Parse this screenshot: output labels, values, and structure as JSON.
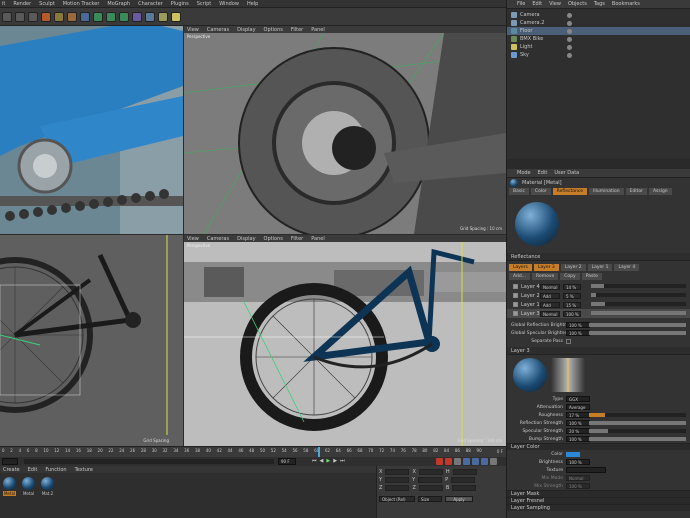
{
  "menubar": {
    "items": [
      "it",
      "Render",
      "Sculpt",
      "Motion Tracker",
      "MoGraph",
      "Character",
      "Plugins",
      "Script",
      "Window",
      "Help"
    ]
  },
  "viewports": {
    "menu": [
      "View",
      "Cameras",
      "Display",
      "Options",
      "Filter",
      "Panel"
    ],
    "tl": {
      "grid": ""
    },
    "tr": {
      "title": "Perspective",
      "grid": "Grid Spacing : 10 cm"
    },
    "bl": {
      "grid": "Grid Spacing"
    },
    "br": {
      "title": "Perspective",
      "grid": "Grid Spacing : 100 cm"
    }
  },
  "timeline": {
    "ticks": [
      "0",
      "2",
      "4",
      "6",
      "8",
      "10",
      "12",
      "14",
      "16",
      "18",
      "20",
      "22",
      "24",
      "26",
      "28",
      "30",
      "32",
      "34",
      "36",
      "38",
      "40",
      "42",
      "44",
      "46",
      "48",
      "50",
      "52",
      "54",
      "56",
      "58",
      "60",
      "62",
      "64",
      "66",
      "68",
      "70",
      "72",
      "74",
      "76",
      "78",
      "80",
      "82",
      "84",
      "86",
      "88",
      "90"
    ],
    "end": "0 F"
  },
  "playbar": {
    "frame": "90 F"
  },
  "matbar": {
    "items": [
      "Create",
      "Edit",
      "Function",
      "Texture"
    ]
  },
  "materials": [
    {
      "name": "Metal"
    },
    {
      "name": "Metal"
    },
    {
      "name": "Mat.2"
    }
  ],
  "coords": {
    "rows": [
      {
        "a": "X",
        "b": "X",
        "c": "H"
      },
      {
        "a": "Y",
        "b": "Y",
        "c": "P"
      },
      {
        "a": "Z",
        "b": "Z",
        "c": "B"
      }
    ],
    "mode": "Object (Rel)",
    "size": "Size",
    "apply": "Apply"
  },
  "objects": {
    "menu": [
      "File",
      "Edit",
      "View",
      "Objects",
      "Tags",
      "Bookmarks"
    ],
    "items": [
      "Camera",
      "Camera.2",
      "Floor",
      "BMX Bike",
      "Light",
      "Sky"
    ]
  },
  "attributes": {
    "menu": [
      "Mode",
      "Edit",
      "User Data"
    ],
    "title": "Material [Metal]",
    "tabs": [
      "Basic",
      "Color",
      "Reflectance",
      "Illumination",
      "Editor",
      "Assign"
    ],
    "reflectance_header": "Reflectance",
    "layer_tabs": [
      "Layers",
      "Layer 3",
      "Layer 2",
      "Layer 1",
      "Layer 4"
    ],
    "buttons": [
      "Add...",
      "Remove",
      "Copy",
      "Paste"
    ],
    "layers": [
      {
        "name": "Layer 4",
        "mode": "Normal",
        "val": "14 %",
        "fill": 0.14
      },
      {
        "name": "Layer 2",
        "mode": "Add",
        "val": "5 %",
        "fill": 0.05
      },
      {
        "name": "Layer 1",
        "mode": "Add",
        "val": "15 %",
        "fill": 0.15
      },
      {
        "name": "Layer 3",
        "mode": "Normal",
        "val": "100 %",
        "fill": 1.0
      }
    ],
    "global": [
      {
        "label": "Global Reflection Brightness",
        "val": "100 %",
        "fill": 1.0
      },
      {
        "label": "Global Specular Brightness",
        "val": "100 %",
        "fill": 1.0
      }
    ],
    "separate": "Separate Pass",
    "layer3_title": "Layer 3",
    "props": [
      {
        "label": "Type",
        "val": "GGX",
        "fill": 0
      },
      {
        "label": "Attenuation",
        "val": "Average",
        "fill": 0
      },
      {
        "label": "Roughness",
        "val": "17 %",
        "fill": 0.17
      },
      {
        "label": "Reflection Strength",
        "val": "100 %",
        "fill": 1.0
      },
      {
        "label": "Specular Strength",
        "val": "20 %",
        "fill": 0.2
      },
      {
        "label": "Bump Strength",
        "val": "100 %",
        "fill": 1.0
      }
    ],
    "layer_color": "Layer Color",
    "color_props": [
      {
        "label": "Color",
        "val": ""
      },
      {
        "label": "Brightness",
        "val": "100 %"
      },
      {
        "label": "Texture",
        "val": ""
      },
      {
        "label": "Mix Mode",
        "val": "Normal"
      },
      {
        "label": "Mix Strength",
        "val": "100 %"
      }
    ],
    "sections": [
      "Layer Mask",
      "Layer Fresnel",
      "Layer Sampling"
    ]
  }
}
